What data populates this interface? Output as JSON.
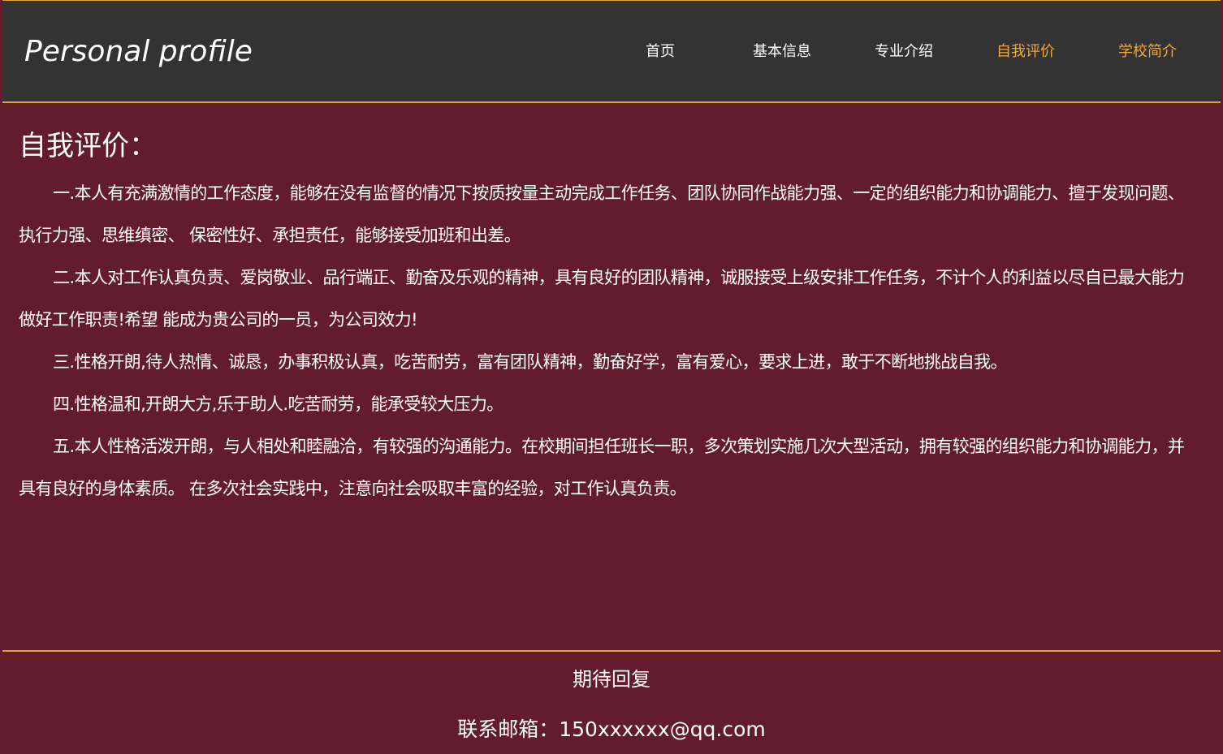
{
  "header": {
    "logo": "Personal profile",
    "nav": [
      {
        "label": "首页",
        "active": false
      },
      {
        "label": "基本信息",
        "active": false
      },
      {
        "label": "专业介绍",
        "active": false
      },
      {
        "label": "自我评价",
        "active": true
      },
      {
        "label": "学校简介",
        "active": true
      }
    ]
  },
  "main": {
    "title": "自我评价：",
    "paragraphs": [
      "一.本人有充满激情的工作态度，能够在没有监督的情况下按质按量主动完成工作任务、团队协同作战能力强、一定的组织能力和协调能力、擅于发现问题、执行力强、思维缜密、 保密性好、承担责任，能够接受加班和出差。",
      "二.本人对工作认真负责、爱岗敬业、品行端正、勤奋及乐观的精神，具有良好的团队精神，诚服接受上级安排工作任务，不计个人的利益以尽自已最大能力做好工作职责!希望 能成为贵公司的一员，为公司效力!",
      "三.性格开朗,待人热情、诚恳，办事积极认真，吃苦耐劳，富有团队精神，勤奋好学，富有爱心，要求上进，敢于不断地挑战自我。",
      "四.性格温和,开朗大方,乐于助人.吃苦耐劳，能承受较大压力。",
      "五.本人性格活泼开朗，与人相处和睦融洽，有较强的沟通能力。在校期间担任班长一职，多次策划实施几次大型活动，拥有较强的组织能力和协调能力，并具有良好的身体素质。 在多次社会实践中，注意向社会吸取丰富的经验，对工作认真负责。"
    ]
  },
  "footer": {
    "title": "期待回复",
    "email": "联系邮箱：150xxxxxx@qq.com"
  },
  "colors": {
    "header_bg": "#333333",
    "page_bg": "#631c2c",
    "accent": "#f0a93a",
    "text": "#ffffff"
  }
}
